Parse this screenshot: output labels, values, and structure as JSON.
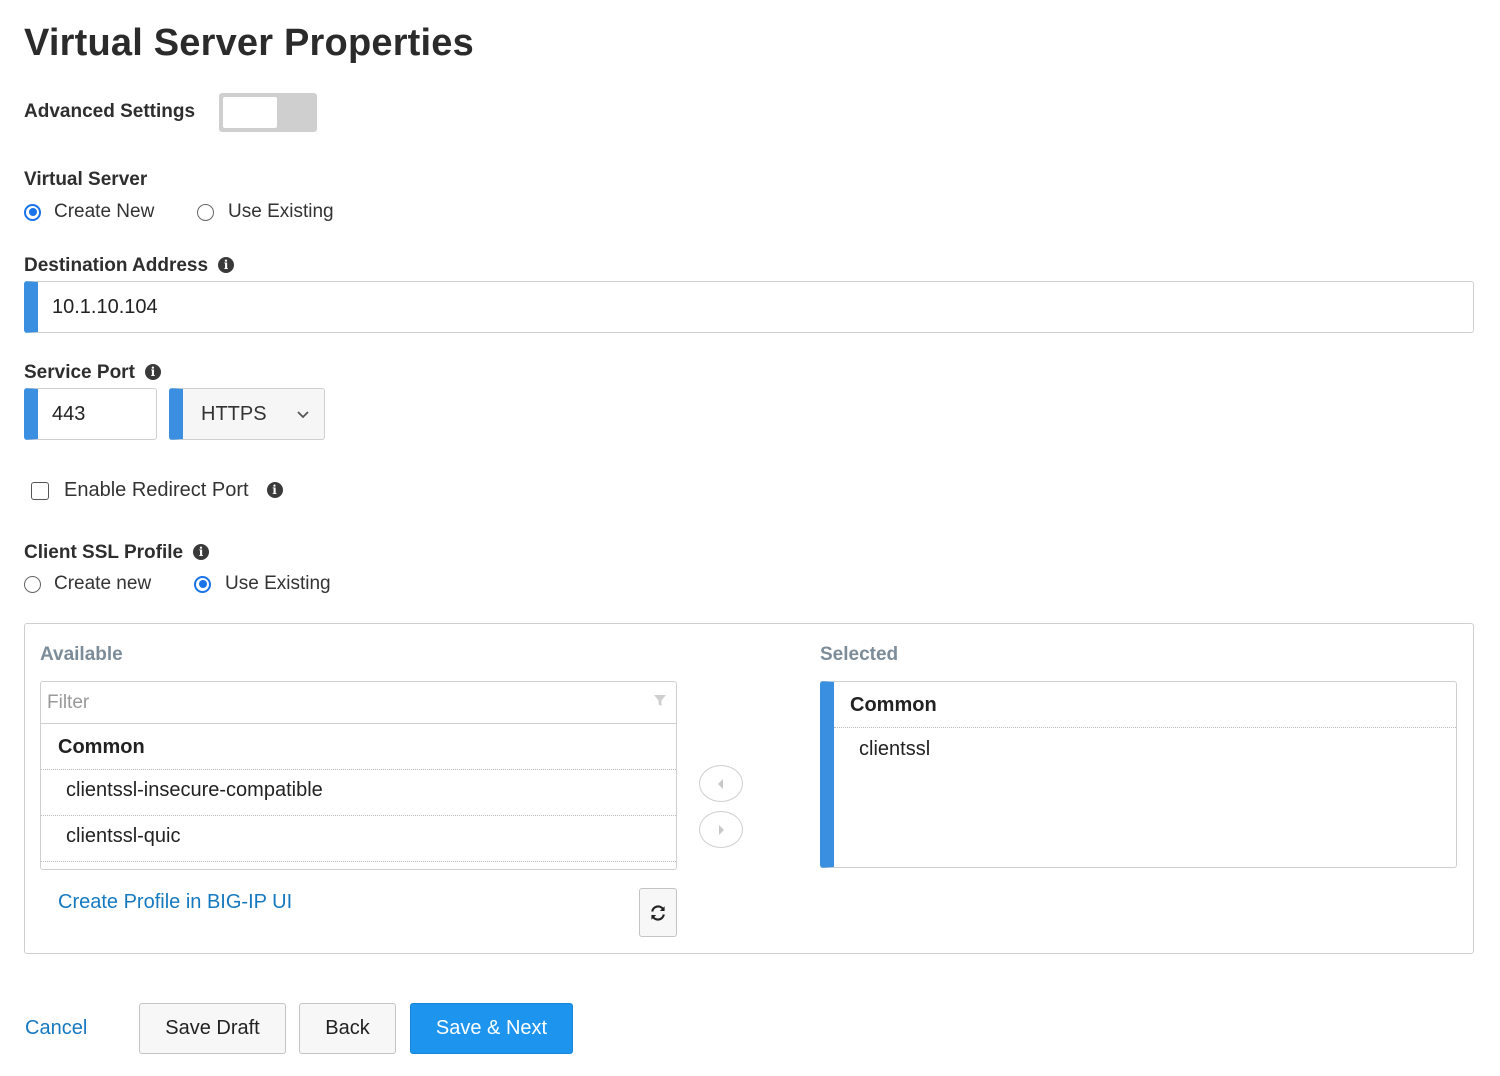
{
  "page_title": "Virtual Server Properties",
  "advanced_settings": {
    "label": "Advanced Settings",
    "enabled": false
  },
  "virtual_server": {
    "label": "Virtual Server",
    "options": [
      "Create New",
      "Use Existing"
    ],
    "selected": "Create New"
  },
  "destination_address": {
    "label": "Destination Address",
    "value": "10.1.10.104"
  },
  "service_port": {
    "label": "Service Port",
    "port_value": "443",
    "protocol_selected": "HTTPS"
  },
  "redirect_port": {
    "label": "Enable Redirect Port",
    "checked": false
  },
  "client_ssl_profile": {
    "label": "Client SSL Profile",
    "options": [
      "Create new",
      "Use Existing"
    ],
    "selected": "Use Existing",
    "available": {
      "heading": "Available",
      "filter_placeholder": "Filter",
      "group": "Common",
      "items": [
        "clientssl-insecure-compatible",
        "clientssl-quic"
      ]
    },
    "selected_list": {
      "heading": "Selected",
      "group": "Common",
      "items": [
        "clientssl"
      ]
    },
    "create_link": "Create Profile in BIG-IP UI"
  },
  "footer": {
    "cancel": "Cancel",
    "save_draft": "Save Draft",
    "back": "Back",
    "save_next": "Save & Next"
  },
  "colors": {
    "accent": "#3b8fe0",
    "primary_button": "#1d95ef",
    "link": "#1679c0"
  }
}
